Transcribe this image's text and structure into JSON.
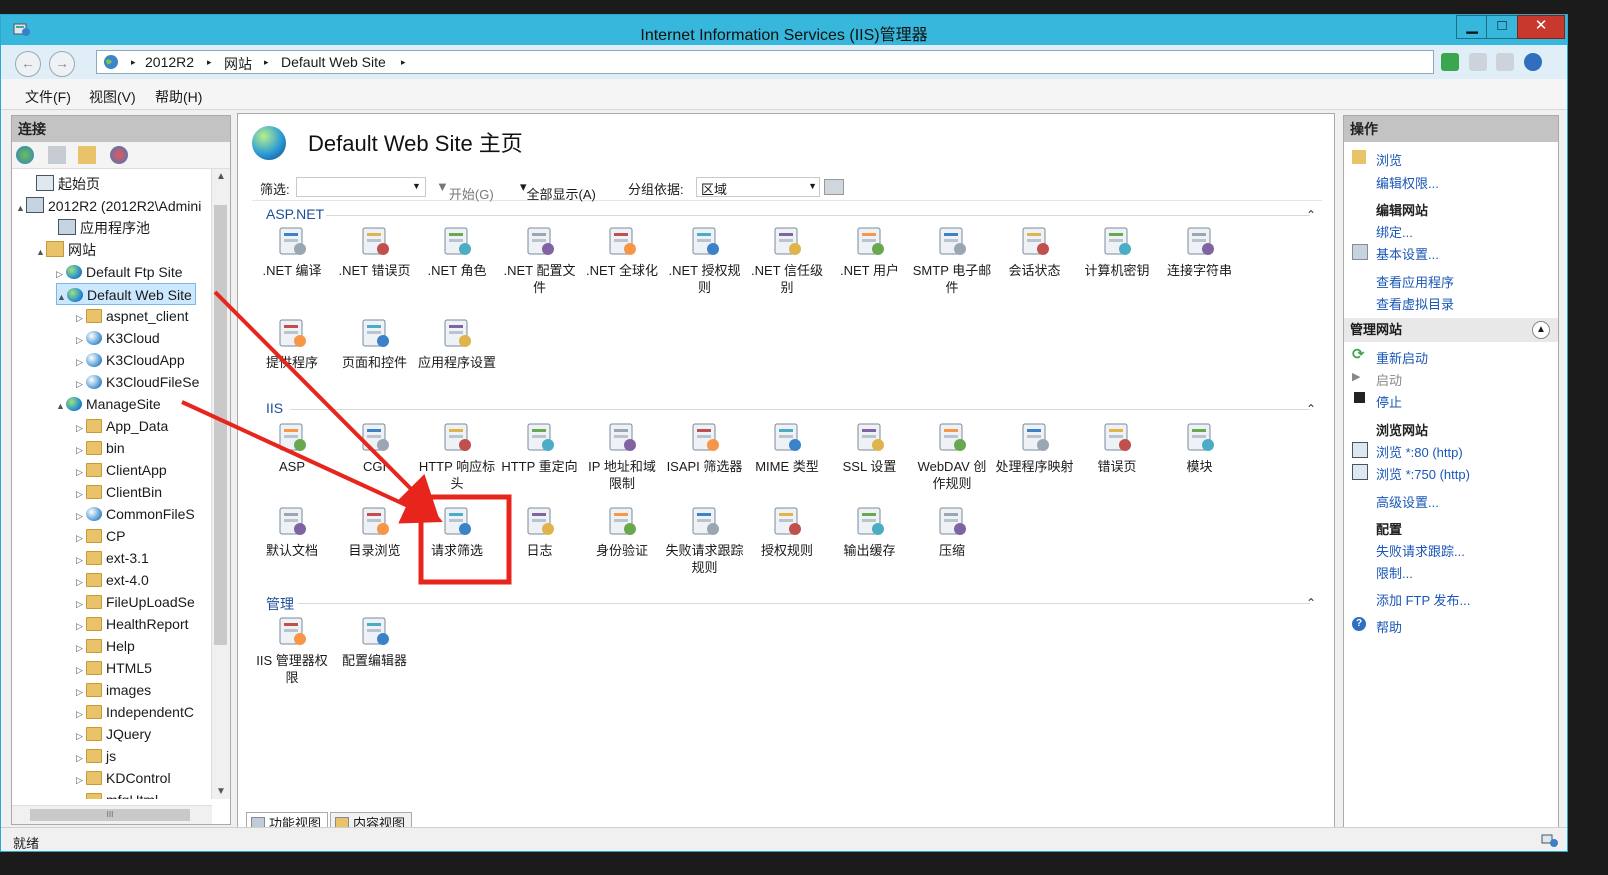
{
  "window": {
    "title": "Internet Information Services (IIS)管理器",
    "min_label": "▁",
    "max_label": "□",
    "close_label": "✕"
  },
  "address": {
    "crumbs": [
      "2012R2",
      "网站",
      "Default Web Site"
    ],
    "sep": "▸"
  },
  "menu": [
    "文件(F)",
    "视图(V)",
    "帮助(H)"
  ],
  "left": {
    "header": "连接",
    "tree": [
      {
        "label": "起始页"
      },
      {
        "label": "2012R2 (2012R2\\Admini"
      },
      {
        "label": "应用程序池"
      },
      {
        "label": "网站"
      },
      {
        "label": "Default Ftp Site"
      },
      {
        "label": "Default Web Site"
      },
      {
        "label": "aspnet_client"
      },
      {
        "label": "K3Cloud"
      },
      {
        "label": "K3CloudApp"
      },
      {
        "label": "K3CloudFileSe"
      },
      {
        "label": "ManageSite"
      },
      {
        "label": "App_Data"
      },
      {
        "label": "bin"
      },
      {
        "label": "ClientApp"
      },
      {
        "label": "ClientBin"
      },
      {
        "label": "CommonFileS"
      },
      {
        "label": "CP"
      },
      {
        "label": "ext-3.1"
      },
      {
        "label": "ext-4.0"
      },
      {
        "label": "FileUpLoadSe"
      },
      {
        "label": "HealthReport"
      },
      {
        "label": "Help"
      },
      {
        "label": "HTML5"
      },
      {
        "label": "images"
      },
      {
        "label": "IndependentC"
      },
      {
        "label": "JQuery"
      },
      {
        "label": "js"
      },
      {
        "label": "KDControl"
      },
      {
        "label": "mfgHtml"
      }
    ]
  },
  "center": {
    "title": "Default Web Site 主页",
    "filter_label": "筛选:",
    "start_label": "开始(G)",
    "showall_label": "全部显示(A)",
    "groupby_label": "分组依据:",
    "groupby_value": "区域",
    "sections": [
      {
        "name": "ASP.NET",
        "items": [
          ".NET 编译",
          ".NET 错误页",
          ".NET 角色",
          ".NET 配置文件",
          ".NET 全球化",
          ".NET 授权规则",
          ".NET 信任级别",
          ".NET 用户",
          "SMTP 电子邮件",
          "会话状态",
          "计算机密钥",
          "连接字符串",
          "提供程序",
          "页面和控件",
          "应用程序设置"
        ]
      },
      {
        "name": "IIS",
        "items": [
          "ASP",
          "CGI",
          "HTTP 响应标头",
          "HTTP 重定向",
          "IP 地址和域限制",
          "ISAPI 筛选器",
          "MIME 类型",
          "SSL 设置",
          "WebDAV 创作规则",
          "处理程序映射",
          "错误页",
          "模块",
          "默认文档",
          "目录浏览",
          "请求筛选",
          "日志",
          "身份验证",
          "失败请求跟踪规则",
          "授权规则",
          "输出缓存",
          "压缩"
        ]
      },
      {
        "name": "管理",
        "items": [
          "IIS 管理器权限",
          "配置编辑器"
        ]
      }
    ],
    "tabs": [
      "功能视图",
      "内容视图"
    ]
  },
  "right": {
    "header": "操作",
    "browse": "浏览",
    "edit_perm": "编辑权限...",
    "edit_site": "编辑网站",
    "bindings": "绑定...",
    "basic": "基本设置...",
    "view_apps": "查看应用程序",
    "view_vdirs": "查看虚拟目录",
    "manage_site": "管理网站",
    "restart": "重新启动",
    "start": "启动",
    "stop": "停止",
    "browse_site": "浏览网站",
    "browse80": "浏览 *:80 (http)",
    "browse750": "浏览 *:750 (http)",
    "advanced": "高级设置...",
    "config": "配置",
    "failed_trace": "失败请求跟踪...",
    "limits": "限制...",
    "add_ftp": "添加 FTP 发布...",
    "help": "帮助"
  },
  "status": "就绪",
  "colors": {
    "titlebar": "#37b7dc",
    "link": "#1957b8",
    "annotation": "#e8251c"
  }
}
